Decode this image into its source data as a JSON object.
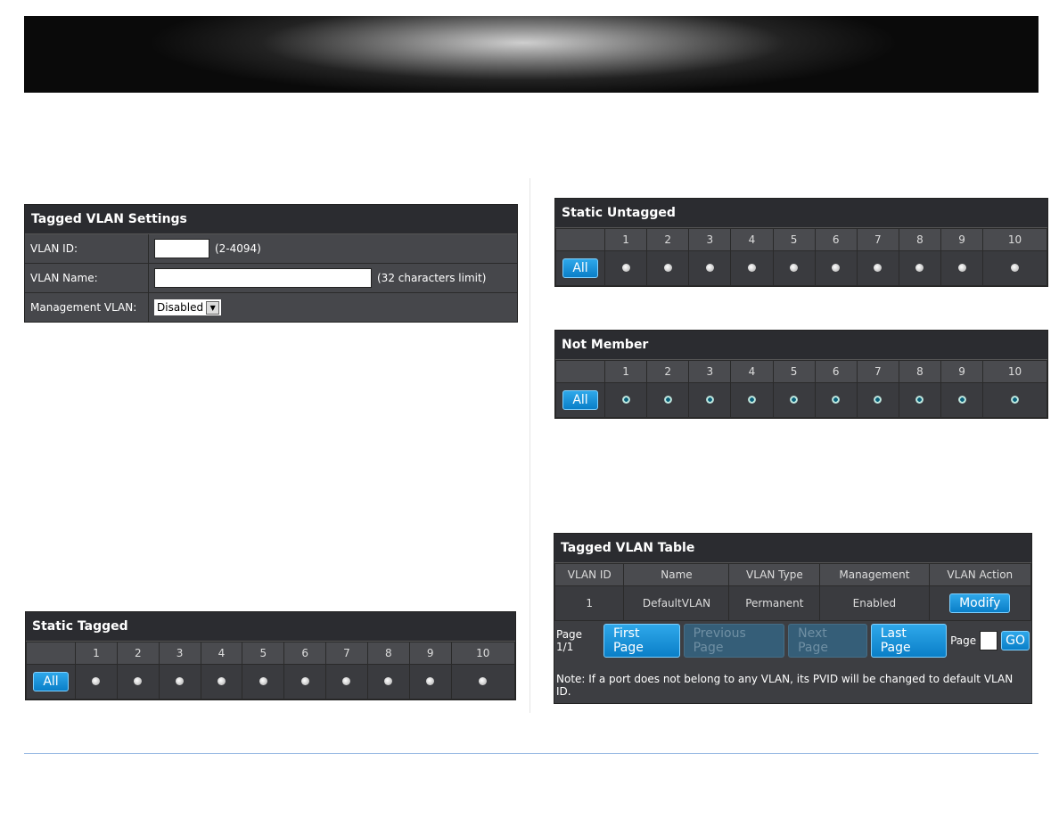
{
  "settings": {
    "title": "Tagged VLAN Settings",
    "vlan_id_label": "VLAN ID:",
    "vlan_id_value": "",
    "vlan_id_hint": "(2-4094)",
    "vlan_name_label": "VLAN Name:",
    "vlan_name_value": "",
    "vlan_name_hint": "(32 characters limit)",
    "mgmt_label": "Management VLAN:",
    "mgmt_value": "Disabled"
  },
  "ports": [
    "1",
    "2",
    "3",
    "4",
    "5",
    "6",
    "7",
    "8",
    "9",
    "10"
  ],
  "all_label": "All",
  "grids": [
    {
      "id": "static-tagged",
      "title": "Static Tagged",
      "selected": false
    },
    {
      "id": "static-untagged",
      "title": "Static Untagged",
      "selected": false
    },
    {
      "id": "not-member",
      "title": "Not Member",
      "selected": true
    }
  ],
  "vlan_table": {
    "title": "Tagged VLAN Table",
    "columns": [
      "VLAN ID",
      "Name",
      "VLAN Type",
      "Management",
      "VLAN Action"
    ],
    "rows": [
      {
        "id": "1",
        "name": "DefaultVLAN",
        "type": "Permanent",
        "management": "Enabled",
        "action": "Modify"
      }
    ],
    "page_info": "Page 1/1",
    "first": "First Page",
    "previous": "Previous Page",
    "next": "Next Page",
    "last": "Last Page",
    "page_label": "Page",
    "go": "GO",
    "note": "Note: If a port does not belong to any VLAN, its PVID will be changed to default VLAN ID."
  }
}
